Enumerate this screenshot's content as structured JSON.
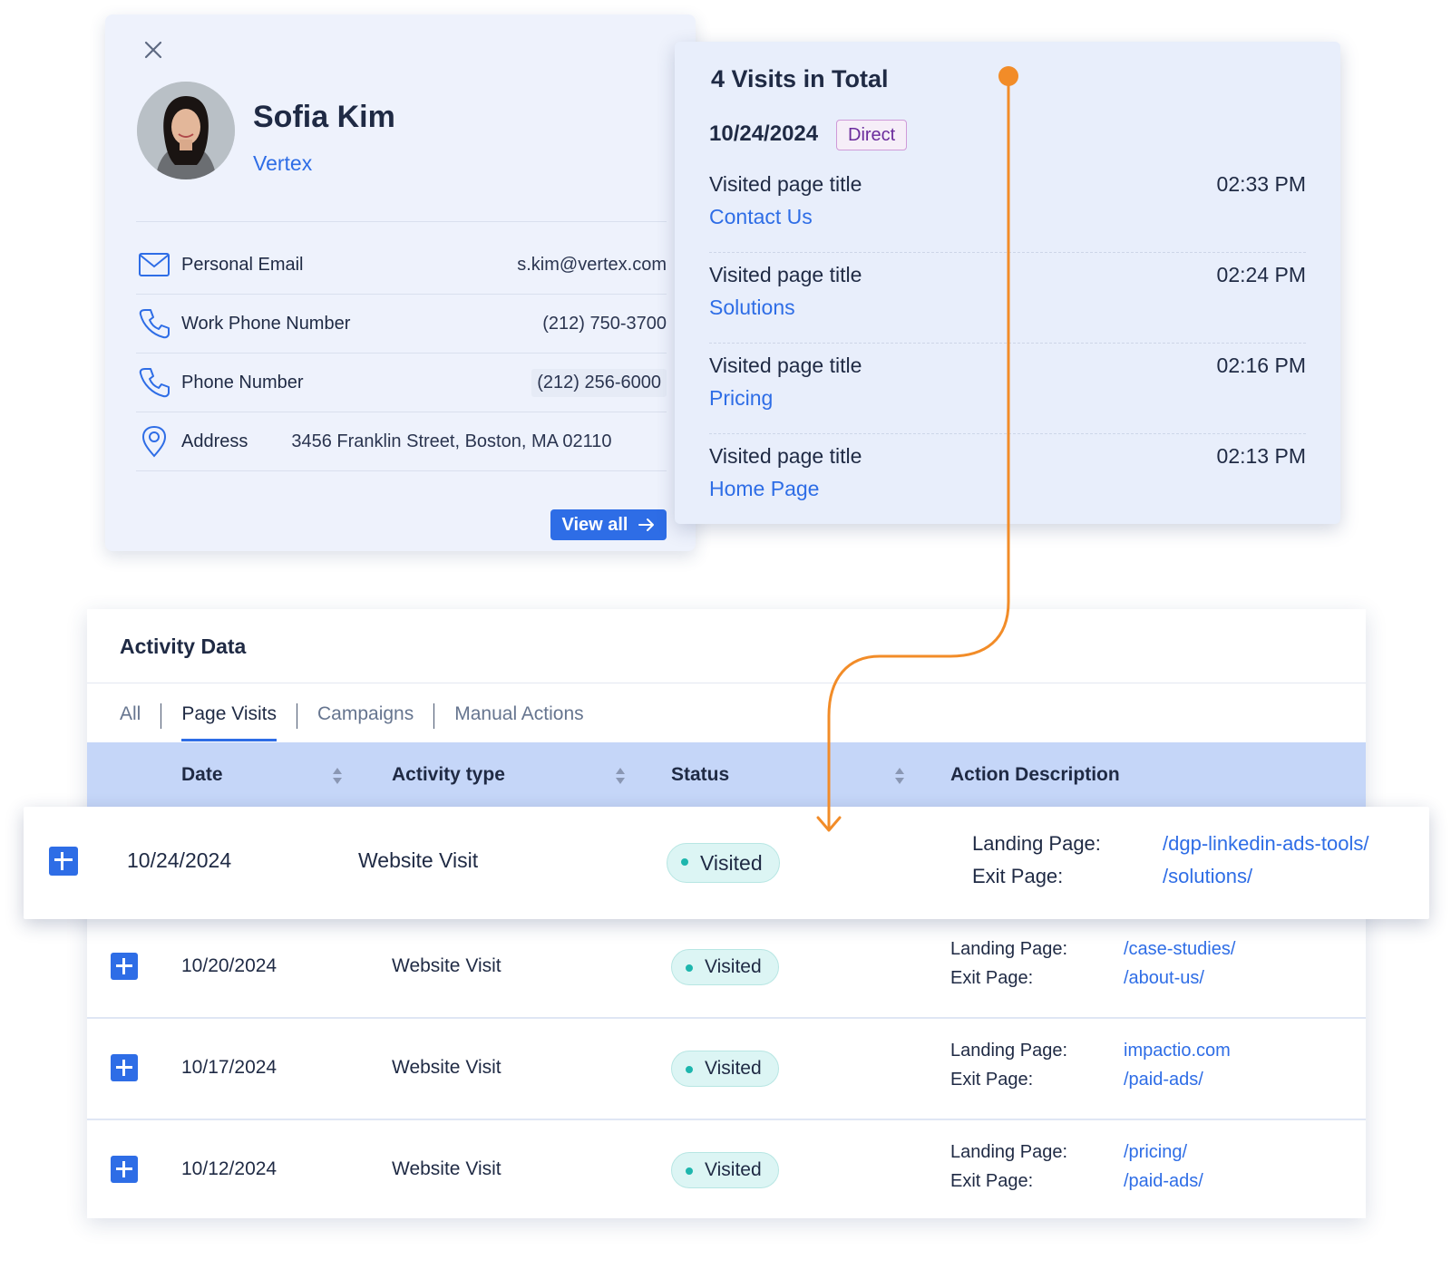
{
  "contact": {
    "name": "Sofia Kim",
    "company": "Vertex",
    "fields": [
      {
        "label": "Personal Email",
        "value": "s.kim@vertex.com",
        "icon": "mail-icon"
      },
      {
        "label": "Work Phone Number",
        "value": "(212) 750-3700",
        "icon": "phone-icon"
      },
      {
        "label": "Phone Number",
        "value": "(212) 256-6000",
        "icon": "phone-icon"
      },
      {
        "label": "Address",
        "value": "3456 Franklin Street, Boston, MA 02110",
        "icon": "location-pin-icon"
      }
    ],
    "view_all_label": "View all"
  },
  "visits": {
    "title": "4 Visits in Total",
    "date": "10/24/2024",
    "source_badge": "Direct",
    "items": [
      {
        "label": "Visited page title",
        "page": "Contact Us",
        "time": "02:33 PM"
      },
      {
        "label": "Visited page title",
        "page": "Solutions",
        "time": "02:24 PM"
      },
      {
        "label": "Visited page title",
        "page": "Pricing",
        "time": "02:16 PM"
      },
      {
        "label": "Visited page title",
        "page": "Home Page",
        "time": "02:13 PM"
      }
    ]
  },
  "activity": {
    "title": "Activity Data",
    "tabs": [
      "All",
      "Page Visits",
      "Campaigns",
      "Manual Actions"
    ],
    "active_tab": "Page Visits",
    "columns": [
      "Date",
      "Activity type",
      "Status",
      "Action Description"
    ],
    "desc_labels": {
      "landing": "Landing Page:",
      "exit": "Exit Page:"
    },
    "rows": [
      {
        "date": "10/24/2024",
        "type": "Website Visit",
        "status": "Visited",
        "landing": "/dgp-linkedin-ads-tools/",
        "exit": "/solutions/"
      },
      {
        "date": "10/20/2024",
        "type": "Website Visit",
        "status": "Visited",
        "landing": "/case-studies/",
        "exit": "/about-us/"
      },
      {
        "date": "10/17/2024",
        "type": "Website Visit",
        "status": "Visited",
        "landing": "impactio.com",
        "exit": "/paid-ads/"
      },
      {
        "date": "10/12/2024",
        "type": "Website Visit",
        "status": "Visited",
        "landing": "/pricing/",
        "exit": "/paid-ads/"
      }
    ]
  },
  "colors": {
    "accent": "#2e6de6",
    "connector": "#f28c28",
    "status_dot": "#1db6ad",
    "header_bg": "#c5d6f8"
  }
}
